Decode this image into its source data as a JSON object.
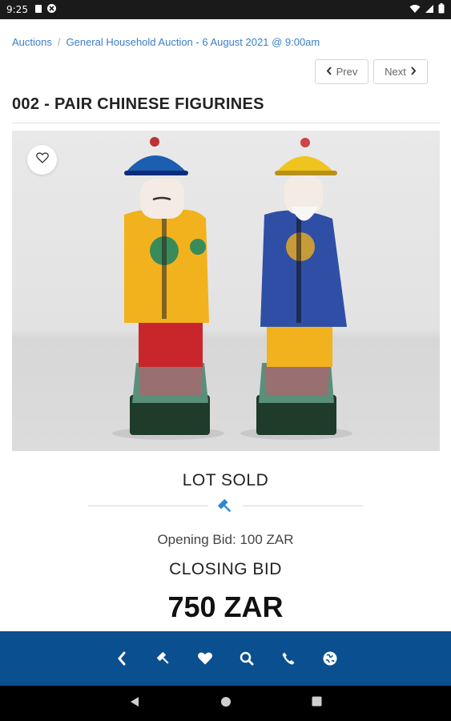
{
  "status_bar": {
    "time": "9:25",
    "icons": [
      "notification-icon",
      "vpn-icon",
      "wifi-icon",
      "signal-icon",
      "battery-icon"
    ]
  },
  "breadcrumb": {
    "items": [
      {
        "label": "Auctions"
      },
      {
        "label": "General Household Auction - 6 August 2021 @ 9:00am"
      }
    ]
  },
  "pager": {
    "prev_label": "Prev",
    "next_label": "Next"
  },
  "lot": {
    "title": "002 - PAIR CHINESE FIGURINES",
    "status": "LOT SOLD",
    "opening_bid": "Opening Bid: 100 ZAR",
    "closing_label": "CLOSING BID",
    "closing_amount": "750 ZAR"
  },
  "bottom_nav": {
    "items": [
      "back-icon",
      "gavel-icon",
      "heart-icon",
      "search-icon",
      "phone-icon",
      "globe-icon"
    ],
    "color": "#0a4f8f"
  },
  "colors": {
    "link": "#3a7ec6",
    "accent": "#2f86d6"
  }
}
